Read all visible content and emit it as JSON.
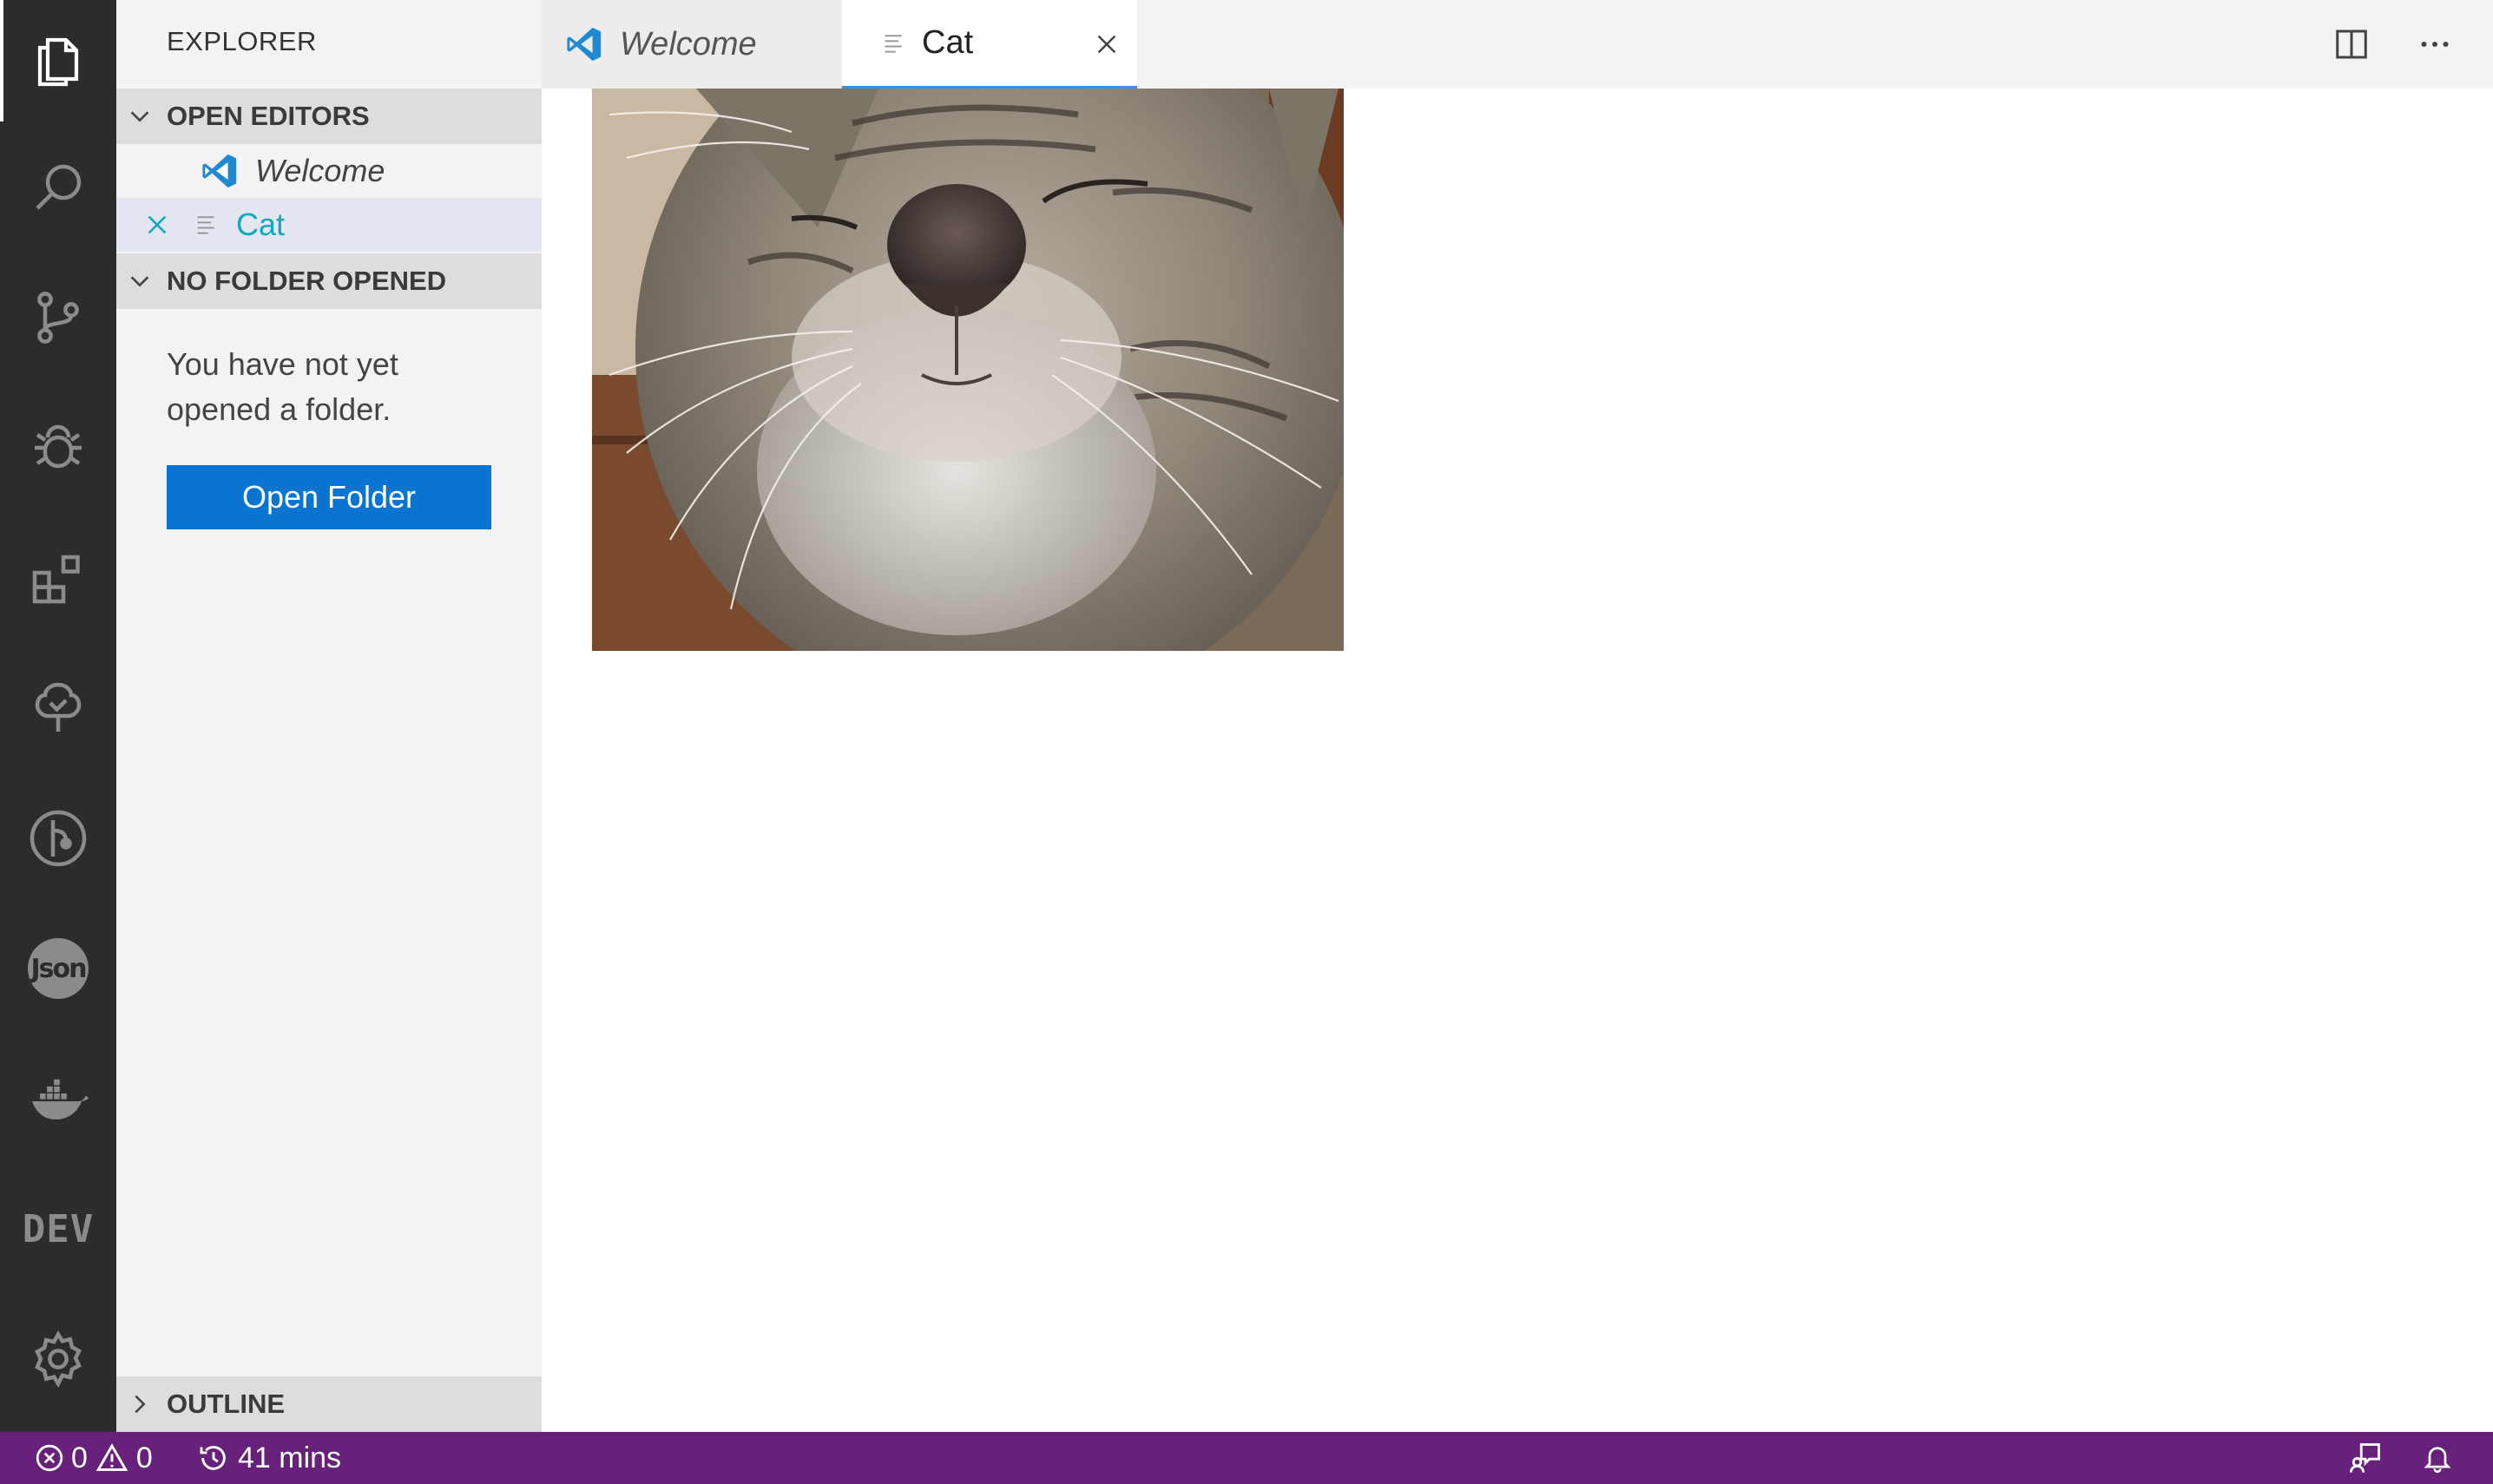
{
  "sidebar": {
    "title": "EXPLORER",
    "open_editors_header": "OPEN EDITORS",
    "open_editors": [
      {
        "label": "Welcome"
      },
      {
        "label": "Cat"
      }
    ],
    "no_folder_header": "NO FOLDER OPENED",
    "no_folder_message": "You have not yet opened a folder.",
    "open_folder_label": "Open Folder",
    "outline_header": "OUTLINE"
  },
  "tabs": [
    {
      "label": "Welcome"
    },
    {
      "label": "Cat"
    }
  ],
  "activitybar": {
    "json_label": "Json",
    "dev_label": "DEV"
  },
  "statusbar": {
    "errors": "0",
    "warnings": "0",
    "time": "41 mins"
  },
  "colors": {
    "status_bar": "#68217a",
    "button": "#0a74d1",
    "accent_cyan": "#0fa9bc",
    "activity_bar": "#2c2c2c"
  }
}
